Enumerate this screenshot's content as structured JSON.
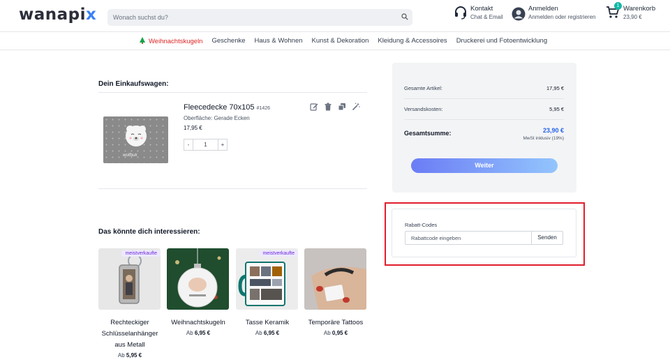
{
  "header": {
    "logo_main": "wanapi",
    "logo_accent": "x",
    "search_placeholder": "Wonach suchst du?",
    "contact": {
      "title": "Kontakt",
      "subtitle": "Chat & Email"
    },
    "login": {
      "title": "Anmelden",
      "subtitle": "Anmelden oder registrieren"
    },
    "cart": {
      "title": "Warenkorb",
      "amount": "23,90 €",
      "count": "1"
    }
  },
  "nav": {
    "items": [
      "Weihnachtskugeln",
      "Geschenke",
      "Haus & Wohnen",
      "Kunst & Dekoration",
      "Kleidung & Accessoires",
      "Druckerei und Fotoentwicklung"
    ]
  },
  "cart": {
    "title": "Dein Einkaufswagen:",
    "item": {
      "name": "Fleecedecke 70x105",
      "sku": "#1426",
      "surface": "Oberfläche: Gerade Ecken",
      "price": "17,95 €",
      "quantity": "1",
      "minus": "-",
      "plus": "+",
      "image_text": "wolfbuk"
    }
  },
  "summary": {
    "items_label": "Gesamte Artikel:",
    "items_value": "17,95 €",
    "shipping_label": "Versandskosten:",
    "shipping_value": "5,95 €",
    "total_label": "Gesamtsumme:",
    "total_value": "23,90 €",
    "vat_note": "MwSt inklusiv (19%)",
    "continue_label": "Weiter"
  },
  "discount": {
    "label": "Rabatt-Codes",
    "placeholder": "Rabattcode eingeben",
    "button": "Senden"
  },
  "recommendations": {
    "title": "Das könnte dich interessieren:",
    "from": "Ab",
    "cards": [
      {
        "name": "Rechteckiger Schlüsselanhänger aus Metall",
        "price": "5,95 €",
        "tag": "meistverkaufte"
      },
      {
        "name": "Weihnachtskugeln",
        "price": "6,95 €",
        "tag": ""
      },
      {
        "name": "Tasse Keramik",
        "price": "6,95 €",
        "tag": "meistverkaufte"
      },
      {
        "name": "Temporäre Tattoos",
        "price": "0,95 €",
        "tag": ""
      }
    ]
  },
  "colors": {
    "accent": "#2563eb",
    "highlight_border": "#e11d2e",
    "nav_active": "#dc2626",
    "badge": "#14b8a6"
  }
}
